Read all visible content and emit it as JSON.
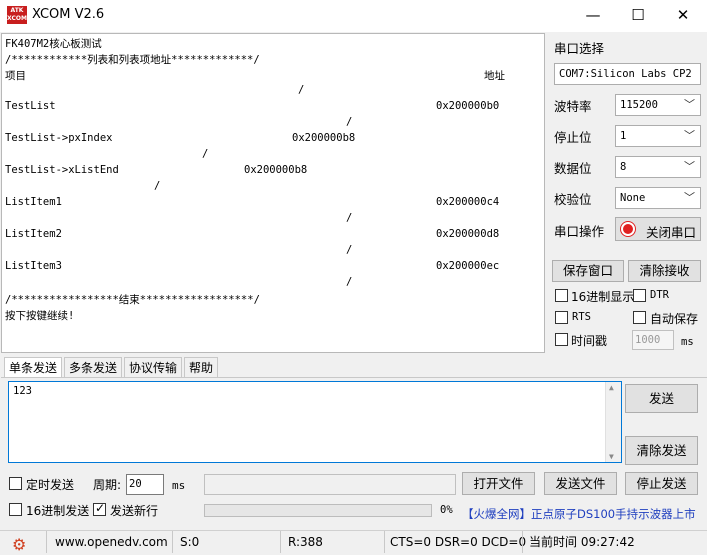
{
  "window": {
    "logo_text": "ATK\nXCOM",
    "title": "XCOM V2.6",
    "minimize_glyph": "—",
    "maximize_glyph": "☐",
    "close_glyph": "✕"
  },
  "receive": {
    "lines": [
      "FK407M2核心板测试",
      "/************列表和列表项地址*************/",
      "项目",
      "TestList",
      "TestList->pxIndex",
      "TestList->xListEnd",
      "ListItem1",
      "ListItem2",
      "ListItem3",
      "/*****************结束******************/",
      "按下按键继续!"
    ],
    "header_address": "地址",
    "values": [
      "0x200000b0",
      "0x200000b8",
      "0x200000b8",
      "0x200000c4",
      "0x200000d8",
      "0x200000ec"
    ],
    "slash": "/"
  },
  "serial": {
    "port_label": "串口选择",
    "port_value": "COM7:Silicon Labs CP2",
    "baud_label": "波特率",
    "baud_value": "115200",
    "stop_label": "停止位",
    "stop_value": "1",
    "data_label": "数据位",
    "data_value": "8",
    "parity_label": "校验位",
    "parity_value": "None",
    "op_label": "串口操作",
    "close_port_button": "关闭串口",
    "status_color": "#e02020"
  },
  "options": {
    "save_window": "保存窗口",
    "clear_receive": "清除接收",
    "hex_display": "16进制显示",
    "dtr": "DTR",
    "rts": "RTS",
    "auto_save": "自动保存",
    "timestamp": "时间戳",
    "timestamp_value": "1000",
    "ms": "ms"
  },
  "tabs": [
    "单条发送",
    "多条发送",
    "协议传输",
    "帮助"
  ],
  "send": {
    "text": "123",
    "send_button": "发送",
    "clear_send_button": "清除发送",
    "timed_send": "定时发送",
    "period_label": "周期:",
    "period_value": "20",
    "ms": "ms",
    "open_file": "打开文件",
    "send_file": "发送文件",
    "stop_send": "停止发送",
    "hex_send": "16进制发送",
    "send_newline": "发送新行",
    "progress_percent": "0%",
    "progress_value": 0,
    "ad_text": "【火爆全网】正点原子DS100手持示波器上市"
  },
  "statusbar": {
    "website": "www.openedv.com",
    "sent": "S:0",
    "received": "R:388",
    "signals": "CTS=0 DSR=0 DCD=0",
    "time": "当前时间 09:27:42"
  }
}
